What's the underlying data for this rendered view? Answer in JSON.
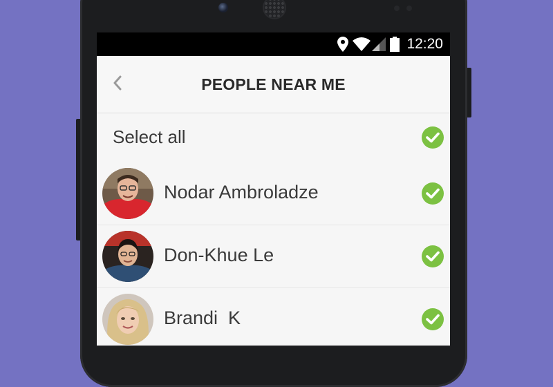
{
  "status_bar": {
    "time": "12:20",
    "icons": [
      "location-icon",
      "wifi-icon",
      "cell-signal-icon",
      "battery-icon"
    ]
  },
  "app_bar": {
    "back_icon": "chevron-left-icon",
    "title": "PEOPLE NEAR ME"
  },
  "select_all": {
    "label": "Select all",
    "checked": true
  },
  "people": [
    {
      "name": "Nodar Ambroladze",
      "checked": true
    },
    {
      "name": "Don-Khue Le",
      "checked": true
    },
    {
      "name": "Brandi  K",
      "checked": true
    }
  ],
  "colors": {
    "background": "#7472c2",
    "check_green": "#7cc142",
    "phone_body": "#1c1d1f"
  }
}
